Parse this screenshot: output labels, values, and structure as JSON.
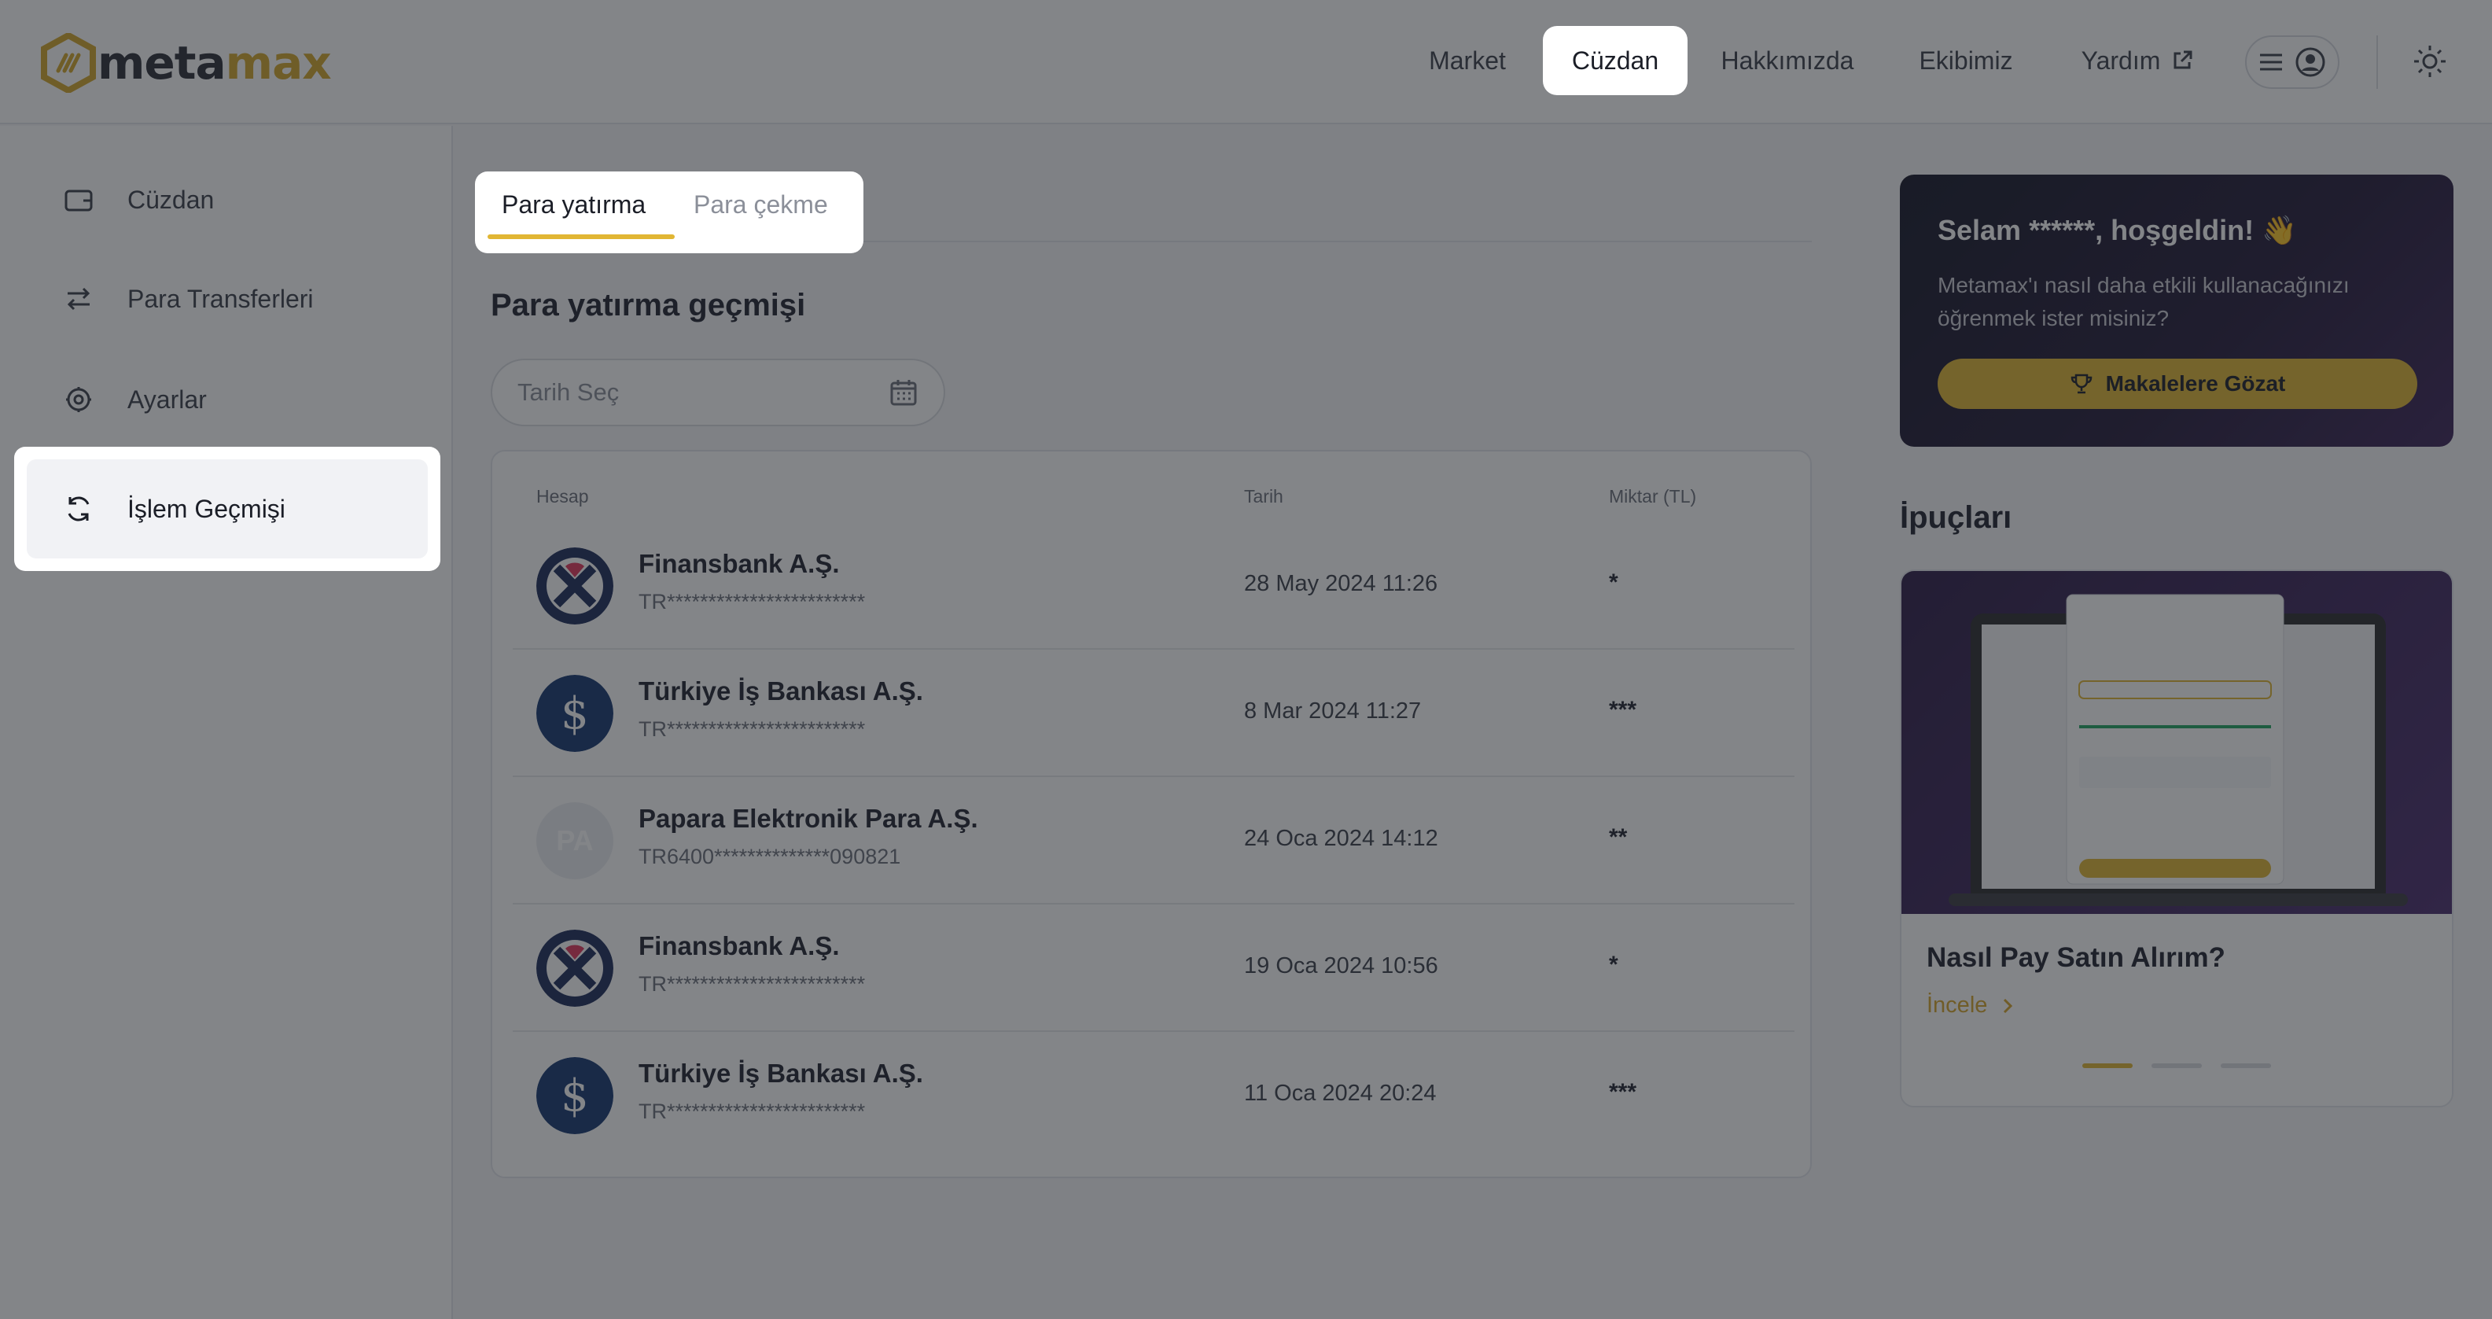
{
  "app": {
    "logo_part1": "meta",
    "logo_part2": "max",
    "brand_color": "#d2a72a",
    "accent_color": "#e1b634"
  },
  "header": {
    "nav": [
      {
        "label": "Market",
        "active": false
      },
      {
        "label": "Cüzdan",
        "active": true
      },
      {
        "label": "Hakkımızda",
        "active": false
      },
      {
        "label": "Ekibimiz",
        "active": false
      },
      {
        "label": "Yardım",
        "active": false,
        "icon": "external-link-icon"
      }
    ],
    "menu_icons": [
      "hamburger-icon",
      "user-circle-icon"
    ],
    "theme_icon": "sun-icon"
  },
  "sidebar": {
    "items": [
      {
        "label": "Cüzdan",
        "icon": "wallet-icon"
      },
      {
        "label": "Para Transferleri",
        "icon": "transfer-arrows-icon"
      },
      {
        "label": "Ayarlar",
        "icon": "settings-gear-icon"
      },
      {
        "label": "İşlem Geçmişi",
        "icon": "refresh-history-icon",
        "active": true
      }
    ]
  },
  "main": {
    "tabs": [
      {
        "label": "Para yatırma",
        "active": true
      },
      {
        "label": "Para çekme",
        "active": false
      }
    ],
    "section_title": "Para yatırma geçmişi",
    "date_picker_placeholder": "Tarih Seç",
    "table": {
      "headers": {
        "account": "Hesap",
        "date": "Tarih",
        "amount": "Miktar (TL)"
      },
      "rows": [
        {
          "bank": "Finansbank A.Ş.",
          "iban": "TR************************",
          "date": "28 May 2024 11:26",
          "amount": "*",
          "logo": "finansbank"
        },
        {
          "bank": "Türkiye İş Bankası A.Ş.",
          "iban": "TR************************",
          "date": "8 Mar 2024 11:27",
          "amount": "***",
          "logo": "isbank"
        },
        {
          "bank": "Papara Elektronik Para A.Ş.",
          "iban": "TR6400**************090821",
          "date": "24 Oca 2024 14:12",
          "amount": "**",
          "logo": "papara",
          "logo_text": "PA"
        },
        {
          "bank": "Finansbank A.Ş.",
          "iban": "TR************************",
          "date": "19 Oca 2024 10:56",
          "amount": "*",
          "logo": "finansbank"
        },
        {
          "bank": "Türkiye İş Bankası A.Ş.",
          "iban": "TR************************",
          "date": "11 Oca 2024 20:24",
          "amount": "***",
          "logo": "isbank"
        }
      ]
    }
  },
  "right": {
    "welcome": {
      "title": "Selam ******, hoşgeldin! 👋",
      "text": "Metamax'ı nasıl daha etkili kullanacağınızı öğrenmek ister misiniz?",
      "button": "Makalelere Gözat",
      "button_icon": "trophy-icon"
    },
    "tips_title": "İpuçları",
    "tip": {
      "heading": "Nasıl Pay Satın Alırım?",
      "link": "İncele",
      "slides": 3,
      "active_slide": 0
    }
  }
}
